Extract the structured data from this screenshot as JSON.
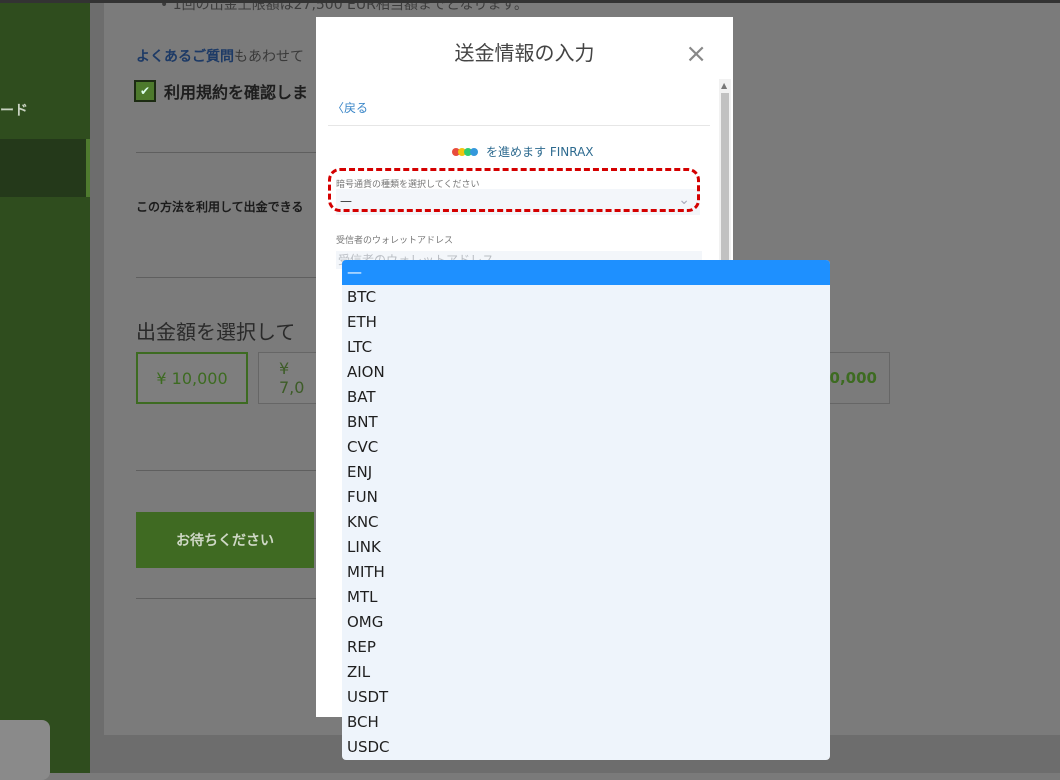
{
  "background_page": {
    "sidebar_label": "ード",
    "bullet_text": "1回の出金上限額は27,500 EUR相当額までとなります。",
    "faq_link": "よくあるご質問",
    "faq_rest": "もあわせて",
    "terms_label": "利用規約を確認しま",
    "method_text": "この方法を利用して出金できる",
    "amount_title": "出金額を選択して",
    "amount_options": [
      "¥ 10,000",
      "¥ 7,0",
      "0,000"
    ],
    "wait_button": "お待ちください"
  },
  "modal": {
    "title": "送金情報の入力",
    "close_icon": "×",
    "back_label": "〈戻る",
    "provider_text": "を進めます FINRAX",
    "currency_label": "暗号通貨の種類を選択してください",
    "currency_value": "—",
    "wallet_label": "受信者のウォレットアドレス",
    "wallet_placeholder": "受信者のウォレットアドレス"
  },
  "dropdown": {
    "options": [
      "—",
      "BTC",
      "ETH",
      "LTC",
      "AION",
      "BAT",
      "BNT",
      "CVC",
      "ENJ",
      "FUN",
      "KNC",
      "LINK",
      "MITH",
      "MTL",
      "OMG",
      "REP",
      "ZIL",
      "USDT",
      "BCH",
      "USDC"
    ],
    "selected_index": 0
  },
  "colors": {
    "accent_blue": "#1e90ff",
    "highlight_red": "#d40000",
    "sidebar_green": "#2f4d1e"
  }
}
